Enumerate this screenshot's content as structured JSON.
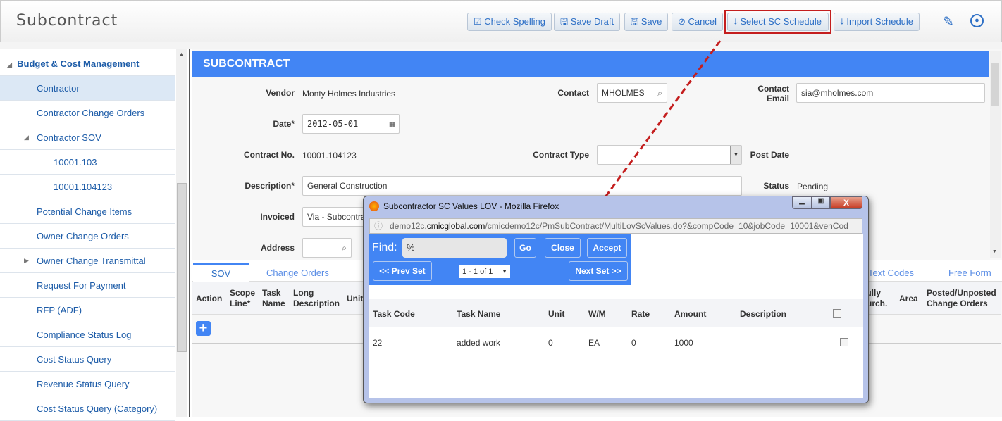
{
  "header": {
    "title": "Subcontract",
    "buttons": [
      {
        "label": "Check Spelling",
        "icon": "check-square-icon"
      },
      {
        "label": "Save Draft",
        "icon": "save-icon"
      },
      {
        "label": "Save",
        "icon": "save-icon"
      },
      {
        "label": "Cancel",
        "icon": "cancel-icon"
      },
      {
        "label": "Select SC Schedule",
        "icon": "download-icon"
      },
      {
        "label": "Import Schedule",
        "icon": "download-icon"
      }
    ]
  },
  "sidebar": {
    "section": "Budget & Cost Management",
    "items": [
      "Contractor",
      "Contractor Change Orders",
      "Contractor SOV",
      "10001.103",
      "10001.104123",
      "Potential Change Items",
      "Owner Change Orders",
      "Owner Change Transmittal",
      "Request For Payment",
      "RFP (ADF)",
      "Compliance Status Log",
      "Cost Status Query",
      "Revenue Status Query",
      "Cost Status Query (Category)"
    ]
  },
  "form": {
    "title": "SUBCONTRACT",
    "vendor_label": "Vendor",
    "vendor": "Monty Holmes Industries",
    "contact_label": "Contact",
    "contact": "MHOLMES",
    "email_label1": "Contact",
    "email_label2": "Email",
    "email": "sia@mholmes.com",
    "date_label": "Date*",
    "date": "2012-05-01",
    "contract_no_label": "Contract No.",
    "contract_no": "10001.104123",
    "contract_type_label": "Contract Type",
    "contract_type": "",
    "post_date_label": "Post Date",
    "description_label": "Description*",
    "description": "General Construction",
    "status_label": "Status",
    "status": "Pending",
    "invoiced_label": "Invoiced",
    "invoiced": "Via - Subcontract",
    "address_label": "Address"
  },
  "tabs": [
    "SOV",
    "Change Orders",
    "Text Codes",
    "Free Form"
  ],
  "table": {
    "headers": [
      "Action",
      "Scope Line*",
      "Task Name",
      "Long Description",
      "Unit",
      "Fully Purch.",
      "Area",
      "Posted/Unposted Change Orders"
    ]
  },
  "modal": {
    "title": "Subcontractor SC Values LOV - Mozilla Firefox",
    "url_pre": "demo12c.",
    "url_domain": "cmicglobal.com",
    "url_post": "/cmicdemo12c/PmSubContract/MultiLovScValues.do?&compCode=10&jobCode=10001&venCod",
    "find_label": "Find:",
    "find_value": "%",
    "go": "Go",
    "close": "Close",
    "accept": "Accept",
    "prev": "<< Prev Set",
    "next": "Next Set >>",
    "page": "1 - 1 of 1",
    "columns": [
      "Task Code",
      "Task Name",
      "Unit",
      "W/M",
      "Rate",
      "Amount",
      "Description"
    ],
    "rows": [
      {
        "task_code": "22",
        "task_name": "added work",
        "unit": "0",
        "wm": "EA",
        "rate": "0",
        "amount": "1000",
        "description": "",
        "checked": false
      }
    ]
  },
  "colors": {
    "accent": "#4285f4",
    "link": "#1d5ca8",
    "highlight": "#c41e1e"
  }
}
